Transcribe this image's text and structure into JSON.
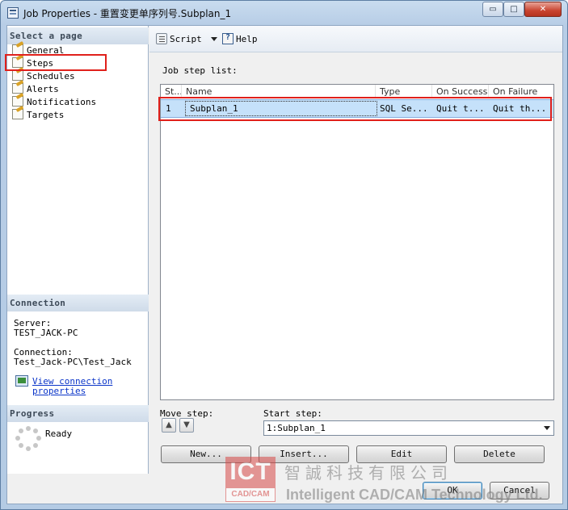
{
  "window": {
    "title": "Job Properties - 重置变更单序列号.Subplan_1",
    "controls": {
      "minimize": "▭",
      "maximize": "□",
      "close": "✕"
    }
  },
  "left": {
    "select_page_header": "Select a page",
    "pages": [
      {
        "label": "General",
        "icon": "page-icon"
      },
      {
        "label": "Steps",
        "icon": "page-icon"
      },
      {
        "label": "Schedules",
        "icon": "page-icon"
      },
      {
        "label": "Alerts",
        "icon": "page-icon"
      },
      {
        "label": "Notifications",
        "icon": "page-icon"
      },
      {
        "label": "Targets",
        "icon": "page-icon"
      }
    ],
    "connection_header": "Connection",
    "server_label": "Server:",
    "server_value": "TEST_JACK-PC",
    "connection_label": "Connection:",
    "connection_value": "Test_Jack-PC\\Test_Jack",
    "view_link_line1": "View connection",
    "view_link_line2": "properties",
    "progress_header": "Progress",
    "progress_status": "Ready"
  },
  "toolbar": {
    "script_label": "Script",
    "help_label": "Help"
  },
  "steps": {
    "list_label": "Job step list:",
    "columns": [
      "St...",
      "Name",
      "Type",
      "On Success",
      "On Failure"
    ],
    "rows": [
      {
        "step": "1",
        "name": "Subplan_1",
        "type": "SQL Se...",
        "on_success": "Quit t...",
        "on_failure": "Quit th..."
      }
    ],
    "move_step_label": "Move step:",
    "move_up": "▲",
    "move_down": "▼",
    "start_step_label": "Start step:",
    "start_step_value": "1:Subplan_1"
  },
  "buttons": {
    "new": "New...",
    "insert": "Insert...",
    "edit": "Edit",
    "delete": "Delete",
    "ok": "OK",
    "cancel": "Cancel"
  },
  "watermark": {
    "logo_top": "ICT",
    "logo_bottom": "CAD/CAM",
    "chinese": "智誠科技有限公司",
    "english": "Intelligent CAD/CAM Technology Ltd."
  },
  "colors": {
    "highlight_box": "#e0201b",
    "selection": "#c5e1fa",
    "link": "#0b35c9"
  }
}
